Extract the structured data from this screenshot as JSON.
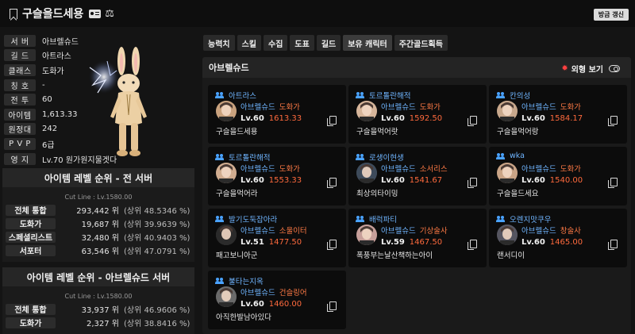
{
  "header": {
    "title": "구슬을드세용",
    "refresh_label": "방금 갱신"
  },
  "profile": {
    "rows": [
      {
        "label": "서 버",
        "value": "아브렐슈드"
      },
      {
        "label": "길 드",
        "value": "아트라스"
      },
      {
        "label": "클래스",
        "value": "도화가"
      },
      {
        "label": "칭 호",
        "value": "-"
      },
      {
        "label": "전 투",
        "value": "60"
      },
      {
        "label": "아이템",
        "value": "1,613.33"
      },
      {
        "label": "원정대",
        "value": "242"
      },
      {
        "label": "P V P",
        "value": "6급"
      },
      {
        "label": "영 지",
        "value": "Lv.70 원가원지물겟다"
      }
    ]
  },
  "rank_all": {
    "title": "아이템 레벨 순위 - 전 서버",
    "cutline": "Cut Line : Lv.1580.00",
    "rows": [
      {
        "label": "전체 통합",
        "rank": "293,442 위",
        "pct": "(상위 48.5346 %)"
      },
      {
        "label": "도화가",
        "rank": "19,687 위",
        "pct": "(상위 39.9639 %)"
      },
      {
        "label": "스페셜리스트",
        "rank": "32,480 위",
        "pct": "(상위 40.9403 %)"
      },
      {
        "label": "서포터",
        "rank": "63,546 위",
        "pct": "(상위 47.0791 %)"
      }
    ]
  },
  "rank_server": {
    "title": "아이템 레벨 순위 - 아브렐슈드 서버",
    "cutline": "Cut Line : Lv.1580.00",
    "rows": [
      {
        "label": "전체 통합",
        "rank": "33,937 위",
        "pct": "(상위 46.9606 %)"
      },
      {
        "label": "도화가",
        "rank": "2,327 위",
        "pct": "(상위 38.8416 %)"
      }
    ]
  },
  "tabs": [
    "능력치",
    "스킬",
    "수집",
    "도표",
    "길드",
    "보유 캐릭터",
    "주간골드획득"
  ],
  "active_tab": "보유 캐릭터",
  "server_panel": {
    "server": "아브렐슈드",
    "appearance_label": "외형 보기"
  },
  "characters": [
    {
      "name": "아트라스",
      "server": "아브렐슈드",
      "class": "도화가",
      "level": "Lv.60",
      "ilvl": "1613.33",
      "guild": "구슬을드세용",
      "color": "#c9a27e"
    },
    {
      "name": "토르톨란해적",
      "server": "아브렐슈드",
      "class": "도화가",
      "level": "Lv.60",
      "ilvl": "1592.50",
      "guild": "구슬을먹어랏",
      "color": "#d6b59a"
    },
    {
      "name": "칸의성",
      "server": "아브렐슈드",
      "class": "도화가",
      "level": "Lv.60",
      "ilvl": "1584.17",
      "guild": "구슬을먹어랑",
      "color": "#c8a88c"
    },
    {
      "name": "토르톨란해적",
      "server": "아브렐슈드",
      "class": "도화가",
      "level": "Lv.60",
      "ilvl": "1553.33",
      "guild": "구슬을먹어라",
      "color": "#d1ad90"
    },
    {
      "name": "로생이현생",
      "server": "아브렐슈드",
      "class": "소서리스",
      "level": "Lv.60",
      "ilvl": "1541.67",
      "guild": "최상의타이밍",
      "color": "#3d4a5a"
    },
    {
      "name": "wka",
      "server": "아브렐슈드",
      "class": "도화가",
      "level": "Lv.60",
      "ilvl": "1540.00",
      "guild": "구슬을드세요",
      "color": "#caa486"
    },
    {
      "name": "발기도둑잡아라",
      "server": "아브렐슈드",
      "class": "소울이터",
      "level": "Lv.51",
      "ilvl": "1477.50",
      "guild": "패고보니아군",
      "color": "#2a2a2a"
    },
    {
      "name": "배럭파티",
      "server": "아브렐슈드",
      "class": "기상술사",
      "level": "Lv.59",
      "ilvl": "1467.50",
      "guild": "폭풍부는날산책하는아이",
      "color": "#c79f9a"
    },
    {
      "name": "오렌지맛쿠우",
      "server": "아브렐슈드",
      "class": "창술사",
      "level": "Lv.60",
      "ilvl": "1465.00",
      "guild": "랜서디이",
      "color": "#555560"
    },
    {
      "name": "불타는지옥",
      "server": "아브렐슈드",
      "class": "건슬링어",
      "level": "Lv.60",
      "ilvl": "1460.00",
      "guild": "아직한발남아있다",
      "color": "#6a6a6a"
    }
  ]
}
